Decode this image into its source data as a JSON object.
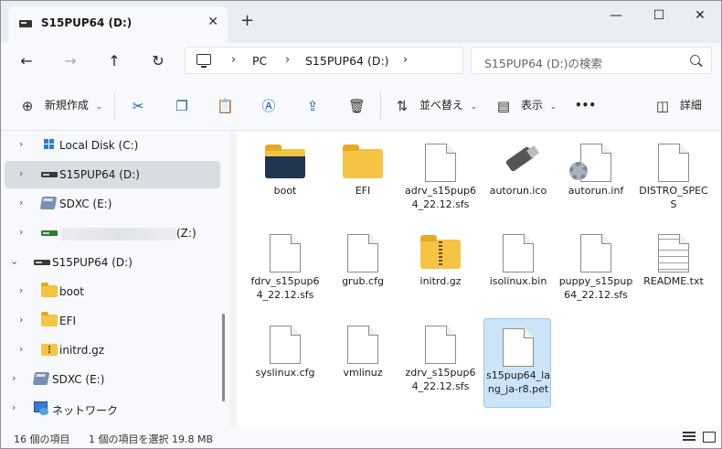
{
  "tab": {
    "title": "S15PUP64 (D:)",
    "close": "✕",
    "new": "+"
  },
  "window_controls": {
    "minimize": "—",
    "maximize": "☐",
    "close": "✕"
  },
  "nav": {
    "back": "←",
    "forward": "→",
    "up": "↑",
    "refresh": "↻"
  },
  "breadcrumb": {
    "sep1": "›",
    "pc": "PC",
    "sep2": "›",
    "drive": "S15PUP64 (D:)",
    "sep3": "›"
  },
  "search": {
    "placeholder": "S15PUP64 (D:)の検索"
  },
  "toolbar": {
    "new_label": "新規作成",
    "sort_label": "並べ替え",
    "view_label": "表示",
    "more_label": "•••",
    "details_label": "詳細"
  },
  "sidebar": {
    "items": [
      {
        "label": "Local Disk (C:)",
        "icon": "windows-drive-icon",
        "arrow": "›"
      },
      {
        "label": "S15PUP64 (D:)",
        "icon": "drive-icon",
        "arrow": "›",
        "selected": true
      },
      {
        "label": "SDXC (E:)",
        "icon": "sd-card-icon",
        "arrow": "›"
      },
      {
        "label": "(Z:)",
        "icon": "network-drive-icon",
        "arrow": "›"
      },
      {
        "label": "S15PUP64 (D:)",
        "icon": "drive-icon",
        "arrow": "⌄",
        "expanded": true
      },
      {
        "label": "boot",
        "icon": "folder-icon",
        "arrow": "›"
      },
      {
        "label": "EFI",
        "icon": "folder-icon",
        "arrow": "›"
      },
      {
        "label": "initrd.gz",
        "icon": "zip-folder-icon",
        "arrow": "›"
      },
      {
        "label": "SDXC (E:)",
        "icon": "sd-card-icon",
        "arrow": "›"
      },
      {
        "label": "ネットワーク",
        "icon": "network-icon",
        "arrow": "›"
      }
    ]
  },
  "files": [
    {
      "name": "boot",
      "type": "folder-dark"
    },
    {
      "name": "EFI",
      "type": "folder"
    },
    {
      "name": "adrv_s15pup64_22.12.sfs",
      "type": "file"
    },
    {
      "name": "autorun.ico",
      "type": "usb"
    },
    {
      "name": "autorun.inf",
      "type": "gear-file"
    },
    {
      "name": "DISTRO_SPECS",
      "type": "file"
    },
    {
      "name": "fdrv_s15pup64_22.12.sfs",
      "type": "file"
    },
    {
      "name": "grub.cfg",
      "type": "file"
    },
    {
      "name": "initrd.gz",
      "type": "zip"
    },
    {
      "name": "isolinux.bin",
      "type": "file"
    },
    {
      "name": "puppy_s15pup64_22.12.sfs",
      "type": "file"
    },
    {
      "name": "README.txt",
      "type": "text"
    },
    {
      "name": "syslinux.cfg",
      "type": "file"
    },
    {
      "name": "vmlinuz",
      "type": "file"
    },
    {
      "name": "zdrv_s15pup64_22.12.sfs",
      "type": "file"
    },
    {
      "name": "s15pup64_lang_ja-r8.pet",
      "type": "file",
      "selected": true
    }
  ],
  "status": {
    "count": "16 個の項目",
    "selection": "1 個の項目を選択  19.8 MB"
  }
}
